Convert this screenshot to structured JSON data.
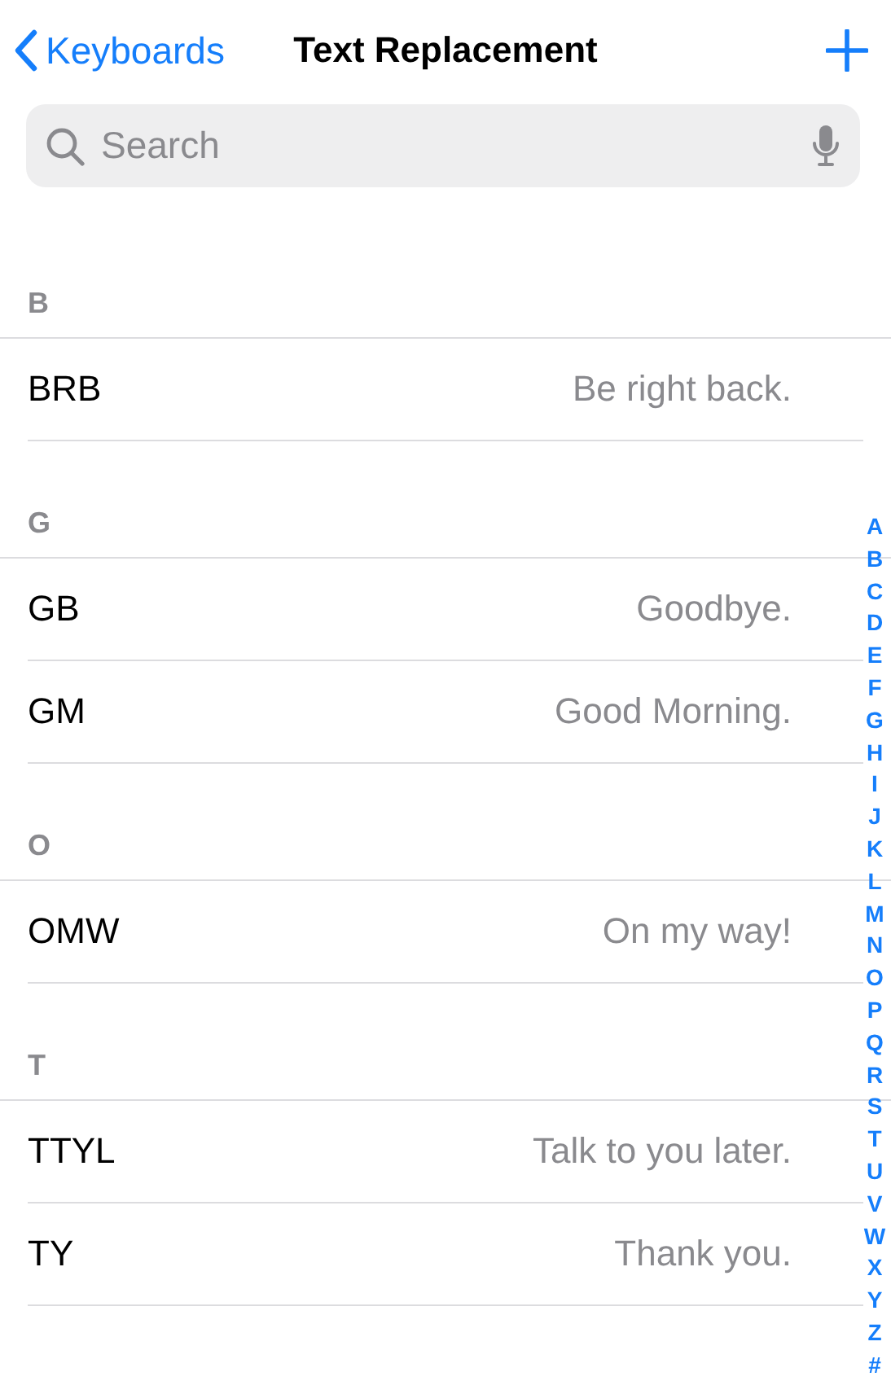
{
  "nav": {
    "back_label": "Keyboards",
    "title": "Text Replacement"
  },
  "search": {
    "placeholder": "Search"
  },
  "sections": [
    {
      "letter": "B",
      "items": [
        {
          "shortcut": "BRB",
          "phrase": "Be right back."
        }
      ]
    },
    {
      "letter": "G",
      "items": [
        {
          "shortcut": "GB",
          "phrase": "Goodbye."
        },
        {
          "shortcut": "GM",
          "phrase": "Good Morning."
        }
      ]
    },
    {
      "letter": "O",
      "items": [
        {
          "shortcut": "OMW",
          "phrase": "On my way!"
        }
      ]
    },
    {
      "letter": "T",
      "items": [
        {
          "shortcut": "TTYL",
          "phrase": "Talk to you later."
        },
        {
          "shortcut": "TY",
          "phrase": "Thank you."
        }
      ]
    }
  ],
  "index": [
    "A",
    "B",
    "C",
    "D",
    "E",
    "F",
    "G",
    "H",
    "I",
    "J",
    "K",
    "L",
    "M",
    "N",
    "O",
    "P",
    "Q",
    "R",
    "S",
    "T",
    "U",
    "V",
    "W",
    "X",
    "Y",
    "Z",
    "#"
  ]
}
